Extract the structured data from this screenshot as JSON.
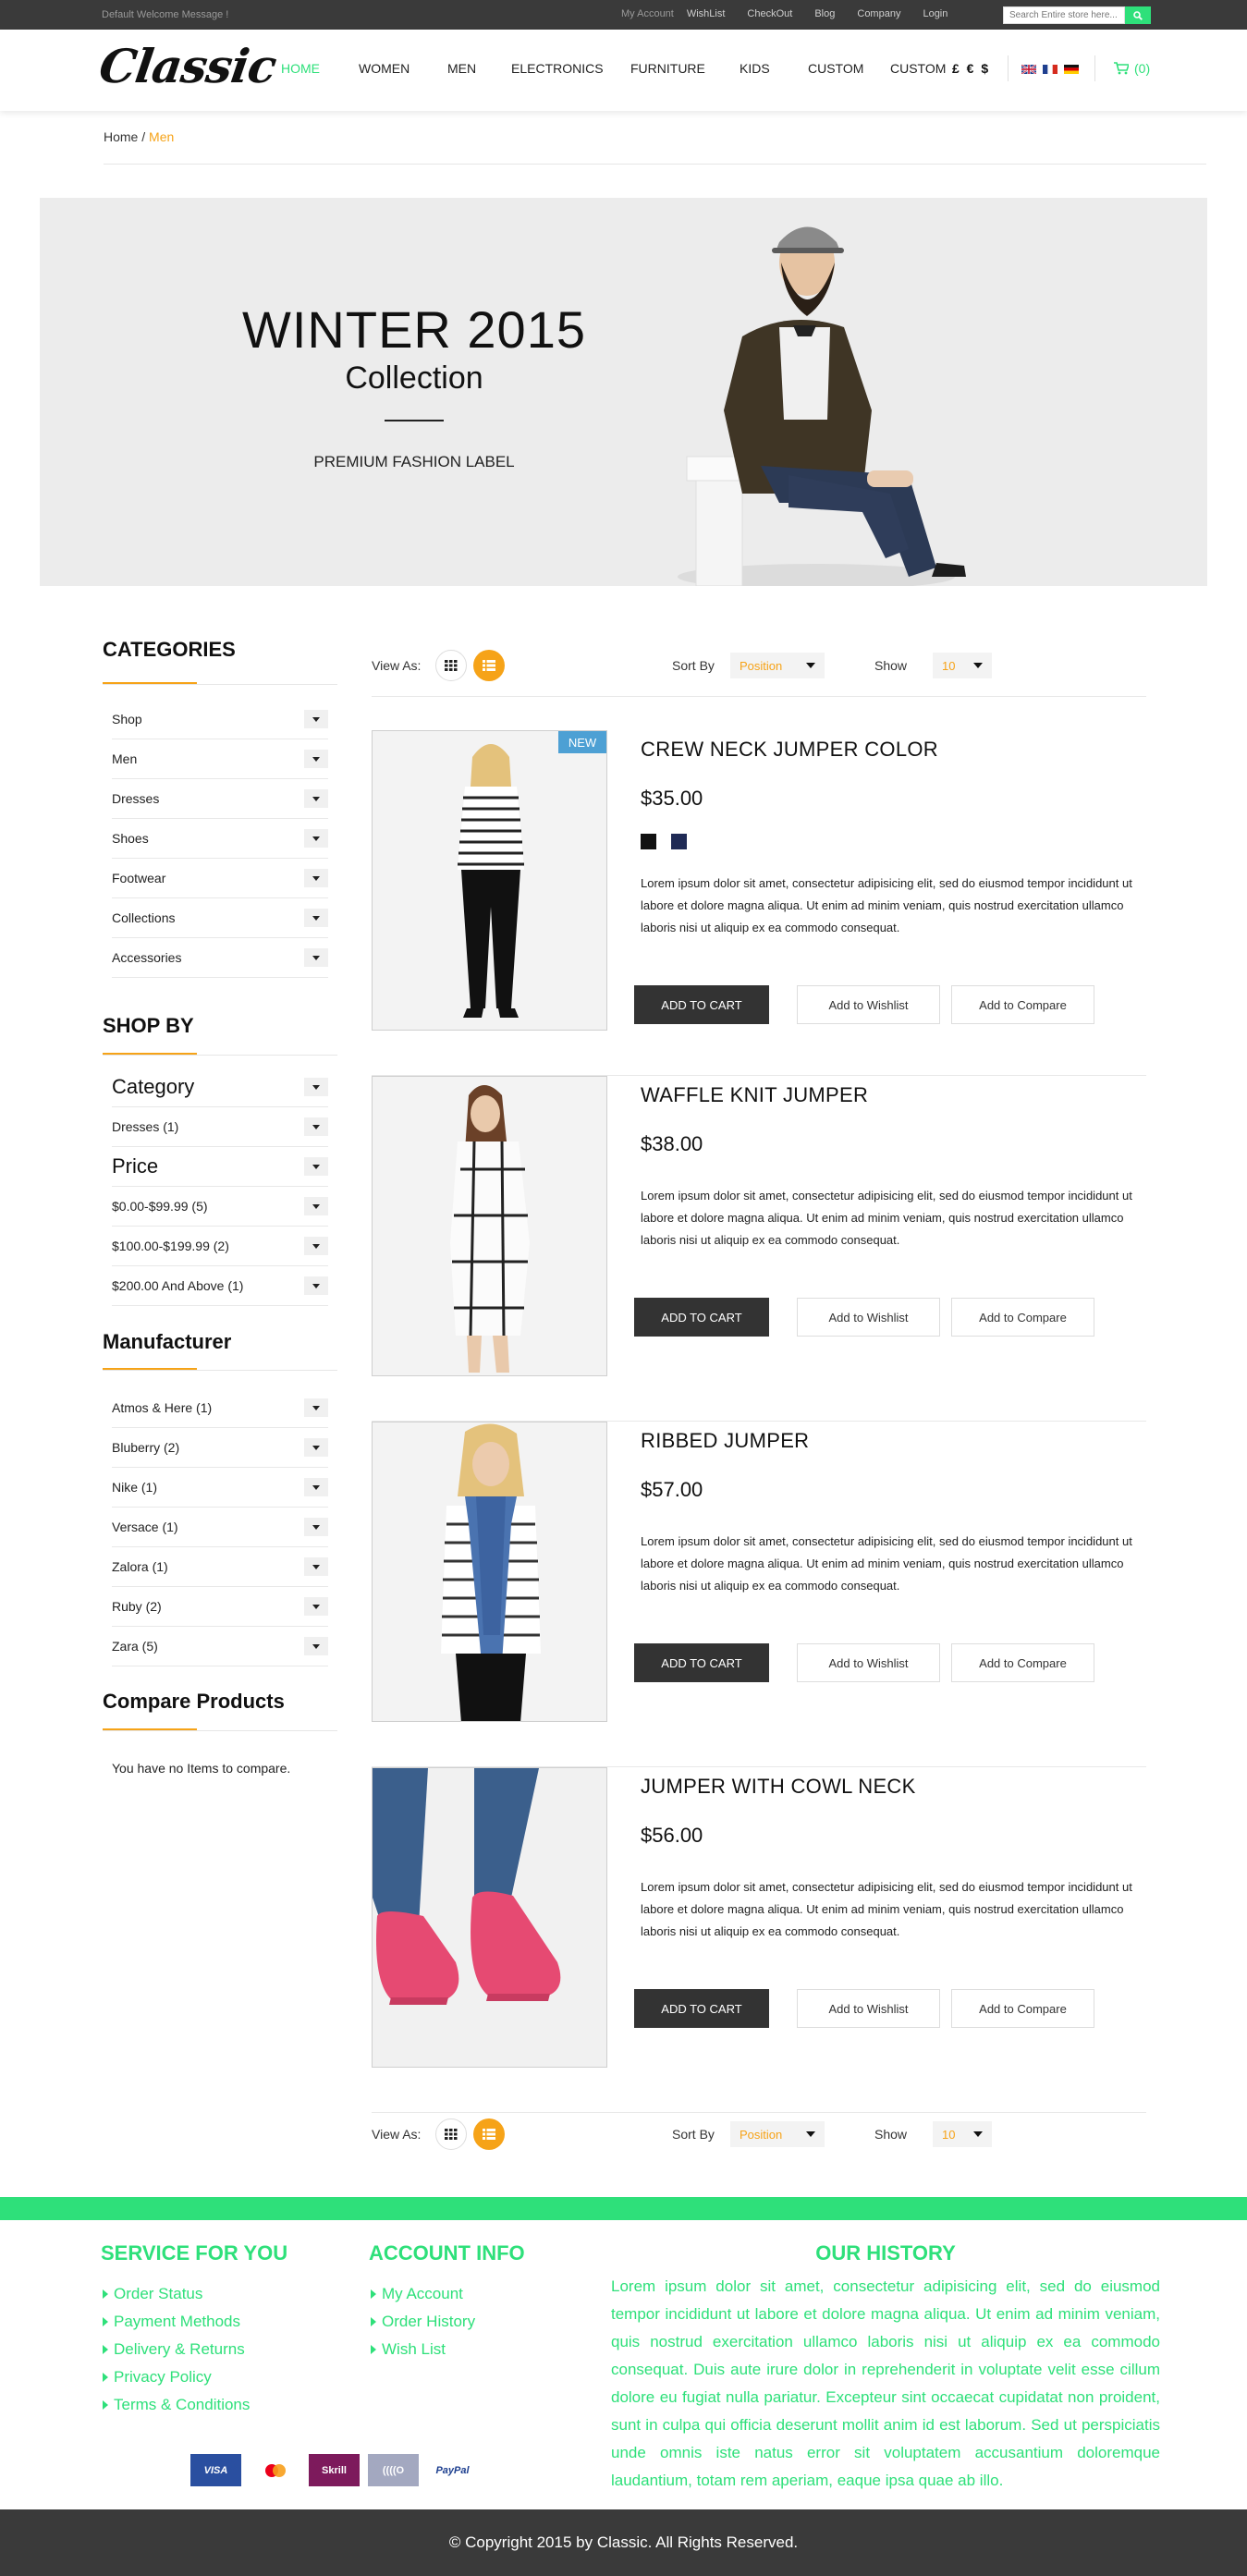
{
  "topbar": {
    "welcome": "Default Welcome Message !",
    "links": [
      "My Account",
      "WishList",
      "CheckOut",
      "Blog",
      "Company",
      "Login"
    ],
    "search_placeholder": "Search Entire store here..."
  },
  "header": {
    "logo": "Classic",
    "nav": [
      "HOME",
      "WOMEN",
      "MEN",
      "ELECTRONICS",
      "FURNITURE",
      "KIDS",
      "CUSTOM",
      "CUSTOM"
    ],
    "currency": "£ € $",
    "cart": "(0)"
  },
  "breadcrumb": {
    "home": "Home",
    "sep": " / ",
    "current": "Men"
  },
  "banner": {
    "title": "WINTER 2015",
    "subtitle": "Collection",
    "tagline": "PREMIUM FASHION LABEL"
  },
  "sidebar": {
    "categories_title": "CATEGORIES",
    "categories": [
      "Shop",
      "Men",
      "Dresses",
      "Shoes",
      "Footwear",
      "Collections",
      "Accessories"
    ],
    "shopby_title": "SHOP BY",
    "category_heading": "Category",
    "category_filters": [
      "Dresses (1)"
    ],
    "price_heading": "Price",
    "price_filters": [
      "$0.00-$99.99 (5)",
      "$100.00-$199.99 (2)",
      "$200.00 And Above (1)"
    ],
    "manufacturer_title": "Manufacturer",
    "manufacturers": [
      "Atmos & Here (1)",
      "Bluberry (2)",
      "Nike (1)",
      "Versace (1)",
      "Zalora (1)",
      "Ruby (2)",
      "Zara (5)"
    ],
    "compare_title": "Compare Products",
    "compare_text": "You have no Items to compare."
  },
  "toolbar": {
    "view_as": "View As:",
    "sort_by": "Sort By",
    "sort_value": "Position",
    "show": "Show",
    "show_value": "10"
  },
  "products": [
    {
      "name": "CREW NECK JUMPER COLOR",
      "price": "$35.00",
      "badge": "NEW",
      "swatches": [
        "#111111",
        "#1f2a55"
      ],
      "desc": "Lorem ipsum dolor sit amet, consectetur adipisicing elit, sed do eiusmod tempor incididunt ut labore et dolore magna aliqua. Ut enim ad minim veniam, quis nostrud exercitation ullamco laboris nisi ut aliquip ex ea commodo consequat.",
      "add_to_cart": "ADD TO CART",
      "wishlist": "Add to Wishlist",
      "compare": "Add to Compare"
    },
    {
      "name": "WAFFLE KNIT JUMPER",
      "price": "$38.00",
      "desc": "Lorem ipsum dolor sit amet, consectetur adipisicing elit, sed do eiusmod tempor incididunt ut labore et dolore magna aliqua. Ut enim ad minim veniam, quis nostrud exercitation ullamco laboris nisi ut aliquip ex ea commodo consequat.",
      "add_to_cart": "ADD TO CART",
      "wishlist": "Add to Wishlist",
      "compare": "Add to Compare"
    },
    {
      "name": "RIBBED JUMPER",
      "price": "$57.00",
      "desc": "Lorem ipsum dolor sit amet, consectetur adipisicing elit, sed do eiusmod tempor incididunt ut labore et dolore magna aliqua. Ut enim ad minim veniam, quis nostrud exercitation ullamco laboris nisi ut aliquip ex ea commodo consequat.",
      "add_to_cart": "ADD TO CART",
      "wishlist": "Add to Wishlist",
      "compare": "Add to Compare"
    },
    {
      "name": "JUMPER WITH COWL NECK",
      "price": "$56.00",
      "desc": "Lorem ipsum dolor sit amet, consectetur adipisicing elit, sed do eiusmod tempor incididunt ut labore et dolore magna aliqua. Ut enim ad minim veniam, quis nostrud exercitation ullamco laboris nisi ut aliquip ex ea commodo consequat.",
      "add_to_cart": "ADD TO CART",
      "wishlist": "Add to Wishlist",
      "compare": "Add to Compare"
    }
  ],
  "footer": {
    "service_title": "SERVICE FOR YOU",
    "service_links": [
      "Order Status",
      "Payment Methods",
      "Delivery & Returns",
      "Privacy Policy",
      "Terms & Conditions"
    ],
    "account_title": "ACCOUNT INFO",
    "account_links": [
      "My Account",
      "Order History",
      "Wish List"
    ],
    "history_title": "OUR HISTORY",
    "history_text": "Lorem ipsum dolor sit amet, consectetur adipisicing elit, sed do eiusmod tempor incididunt ut labore et dolore magna aliqua. Ut enim ad minim veniam, quis nostrud exercitation ullamco laboris nisi ut aliquip ex ea commodo consequat. Duis aute irure dolor in reprehenderit in voluptate velit esse cillum dolore eu fugiat nulla pariatur. Excepteur sint occaecat cupidatat non proident, sunt in culpa qui officia deserunt mollit anim id est laborum. Sed ut perspiciatis unde omnis iste natus error sit voluptatem accusantium doloremque laudantium, totam rem aperiam, eaque ipsa quae ab illo.",
    "payments": [
      "VISA",
      "mastercard-icon",
      "Skrill",
      "((((O",
      "PayPal"
    ],
    "copyright": "© Copyright 2015 by Classic. All Rights Reserved."
  },
  "colors": {
    "accent": "#2ee07a",
    "orange": "#f6a318",
    "dark": "#3a3a3a",
    "badge": "#4da0d4"
  }
}
